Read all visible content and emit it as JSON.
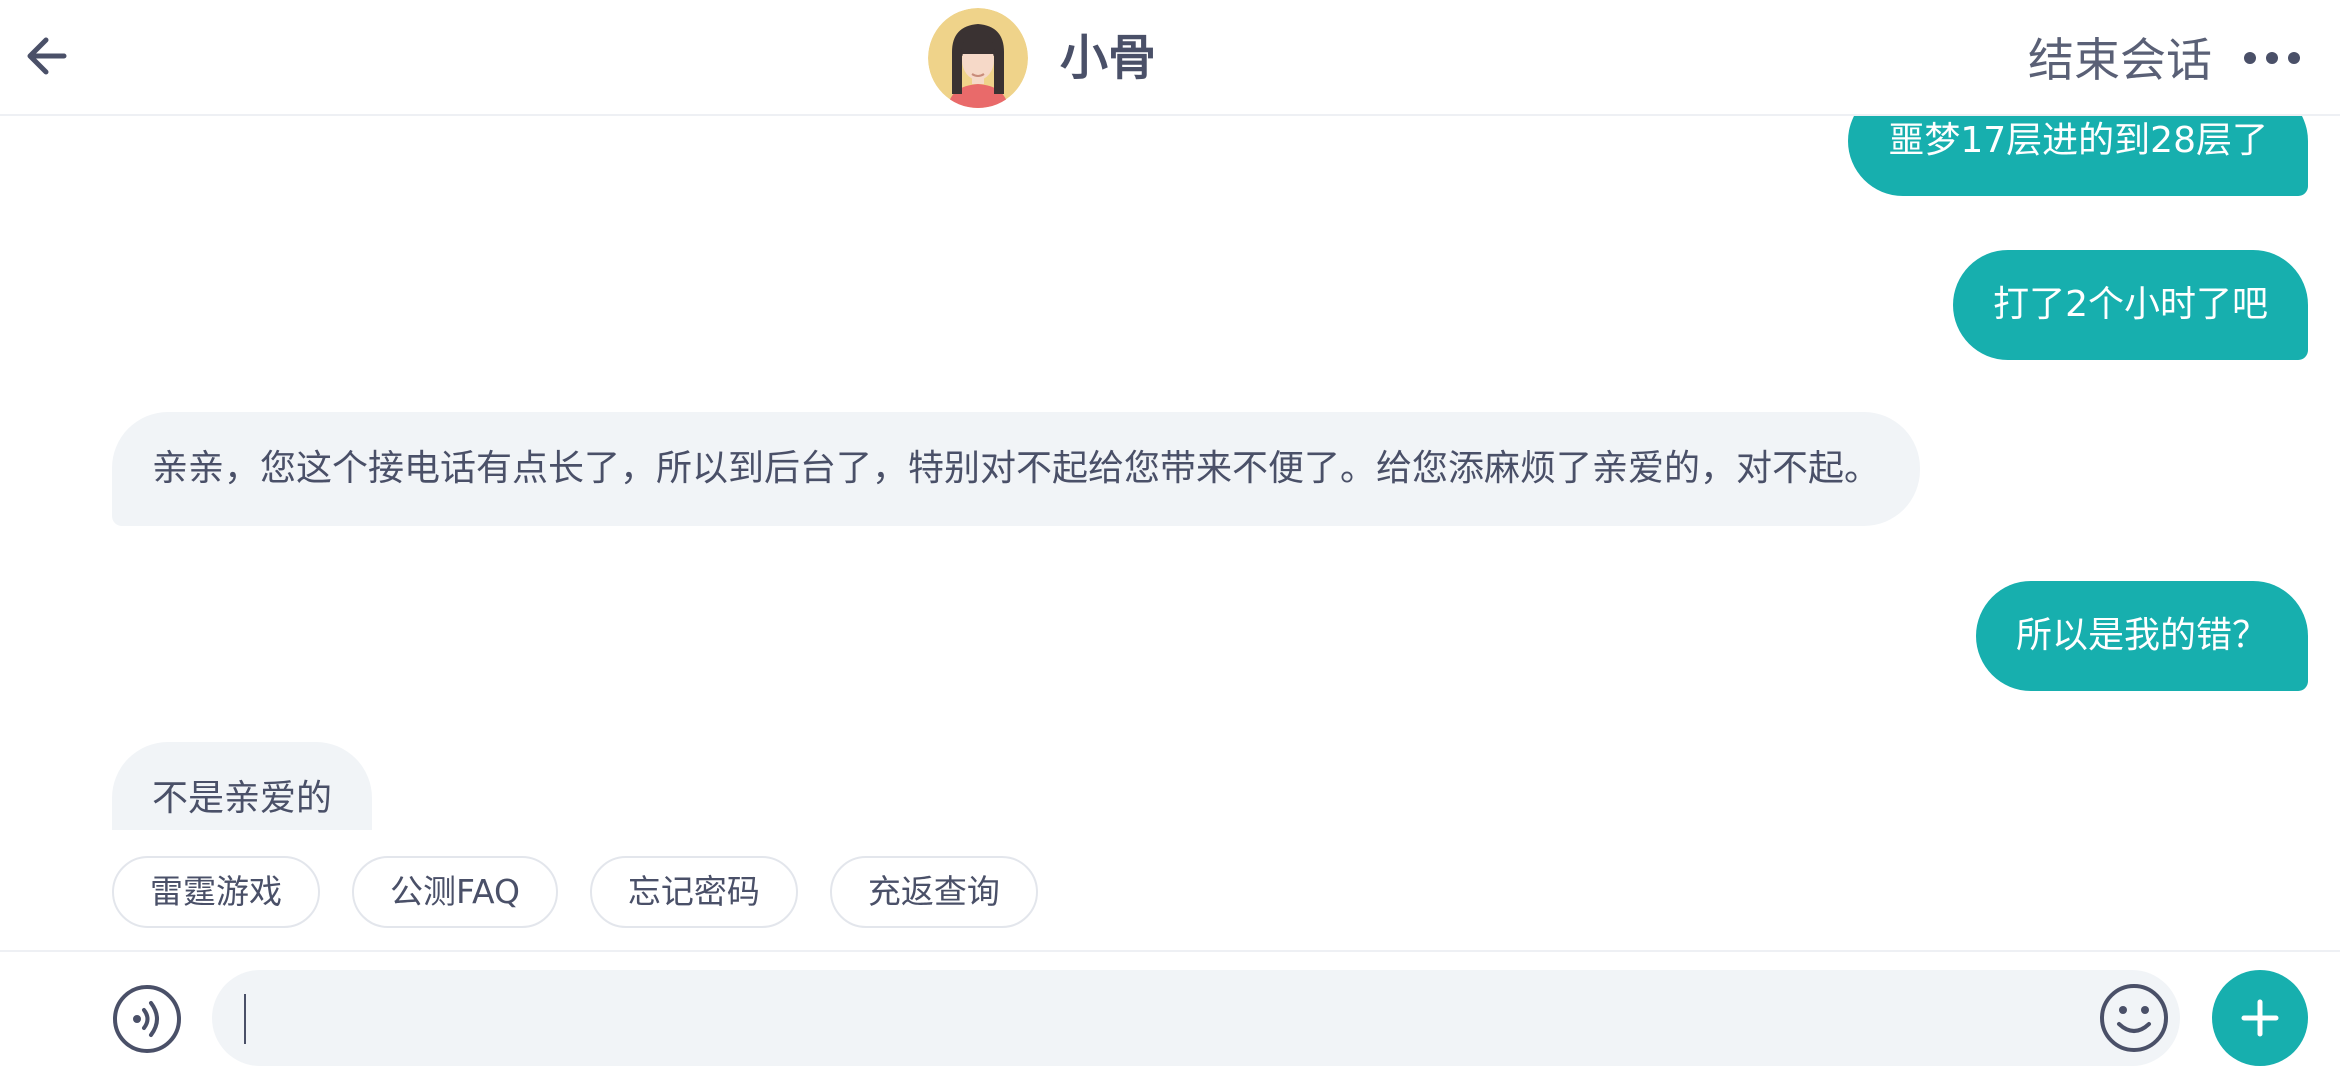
{
  "header": {
    "back_icon": "arrow-left-icon",
    "agent_name": "小骨",
    "end_session_label": "结束会话",
    "more_icon": "more-horizontal-icon"
  },
  "messages": [
    {
      "direction": "out",
      "text": "噩梦17层进的到28层了"
    },
    {
      "direction": "out",
      "text": "打了2个小时了吧"
    },
    {
      "direction": "in",
      "text": "亲亲，您这个接电话有点长了，所以到后台了，特别对不起给您带来不便了。给您添麻烦了亲爱的，对不起。"
    },
    {
      "direction": "out",
      "text": "所以是我的错？"
    },
    {
      "direction": "in",
      "text": "不是亲爱的"
    }
  ],
  "quick_replies": [
    {
      "label": "雷霆游戏"
    },
    {
      "label": "公测FAQ"
    },
    {
      "label": "忘记密码"
    },
    {
      "label": "充返查询"
    }
  ],
  "input": {
    "value": "",
    "placeholder": ""
  },
  "colors": {
    "accent": "#17afae",
    "incoming_bubble": "#f1f4f7",
    "text": "#4a5068"
  }
}
